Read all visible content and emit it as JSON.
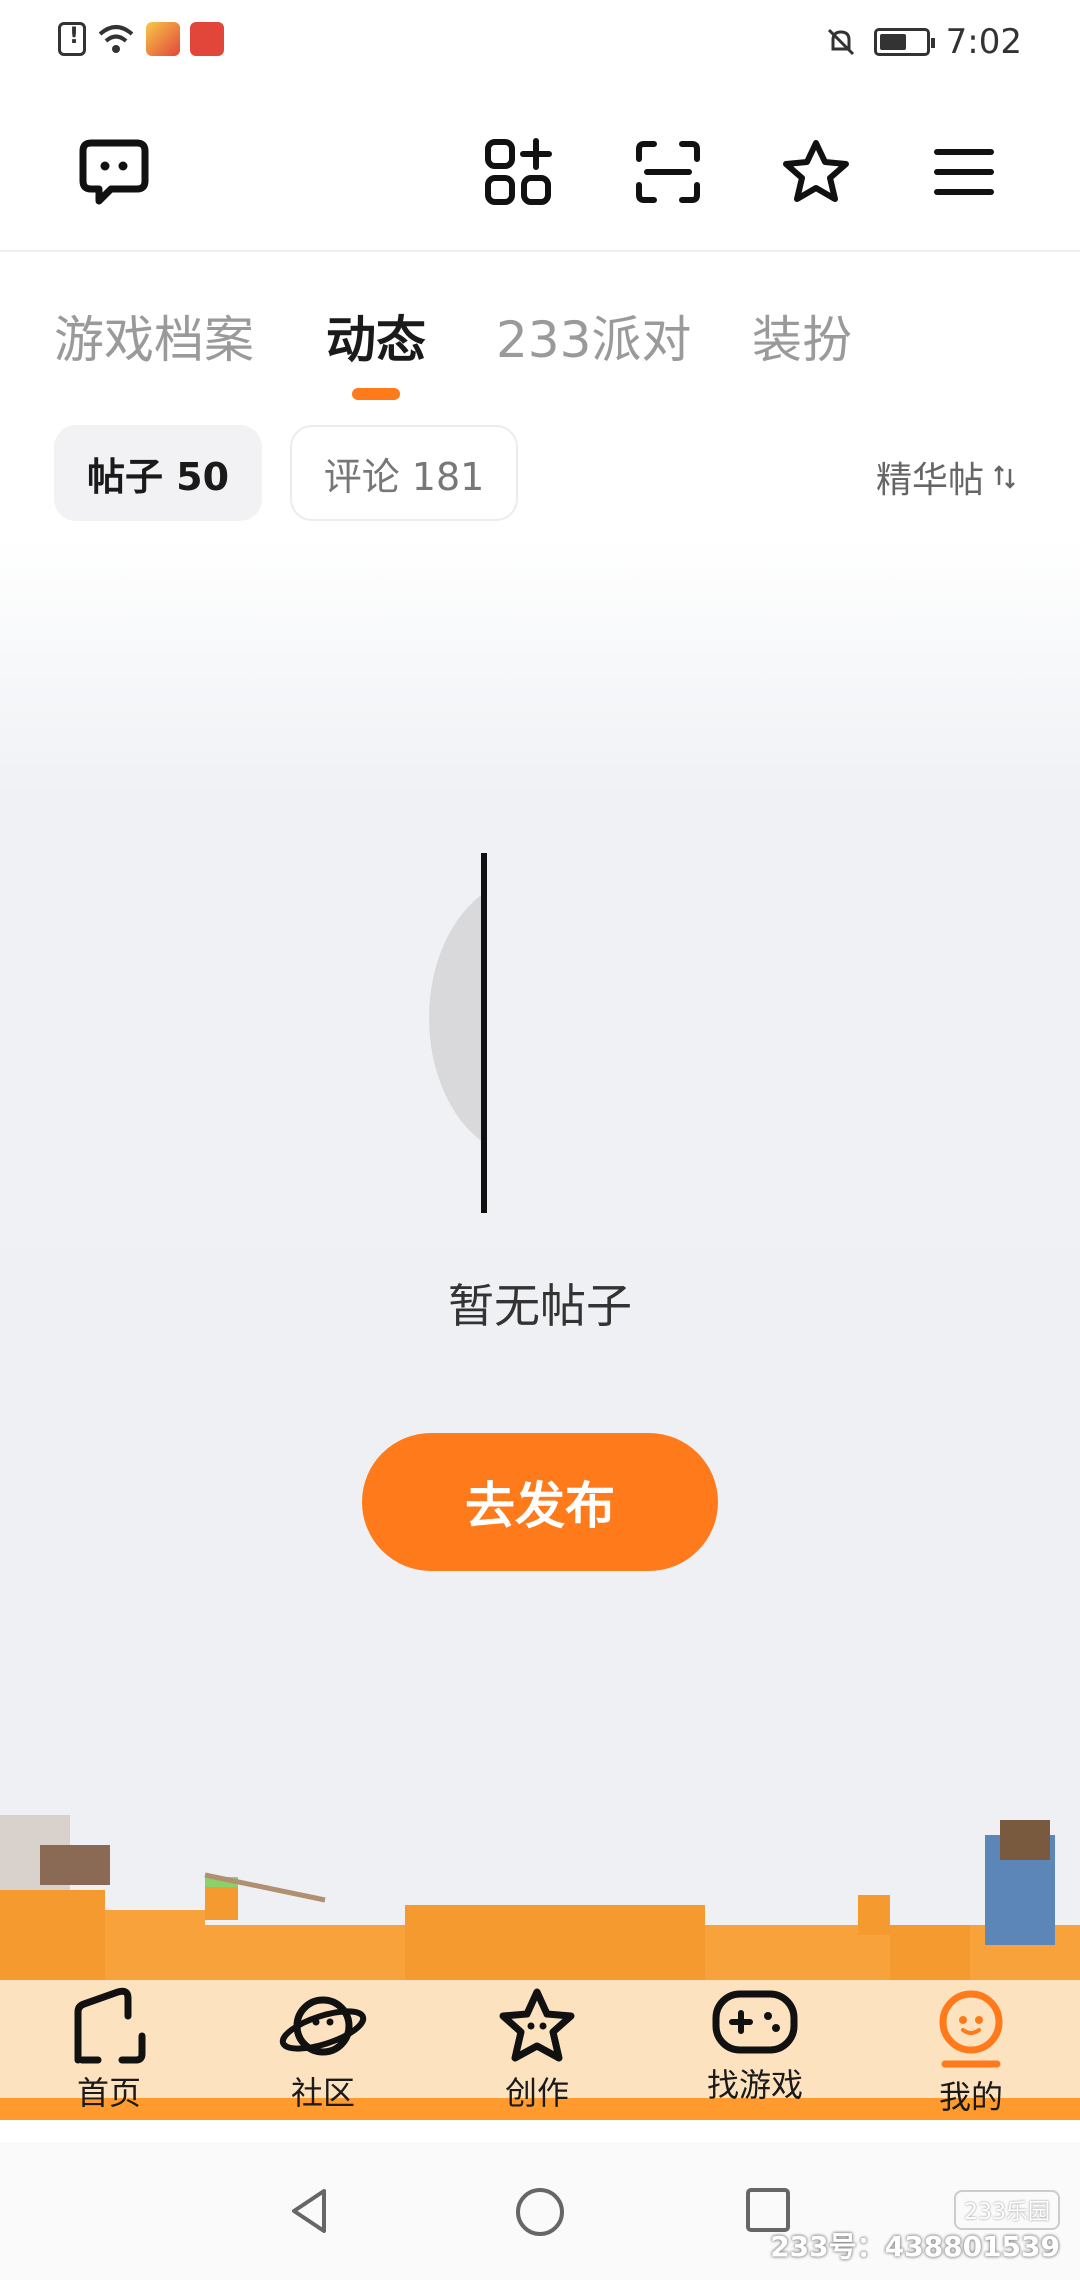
{
  "status_bar": {
    "time": "7:02"
  },
  "tabs": [
    {
      "label": "游戏档案"
    },
    {
      "label": "动态"
    },
    {
      "label": "233派对"
    },
    {
      "label": "装扮"
    }
  ],
  "filters": {
    "posts": "帖子 50",
    "comments": "评论 181",
    "sort": "精华帖"
  },
  "empty": {
    "text": "暂无帖子",
    "button": "去发布"
  },
  "bottom_nav": [
    {
      "label": "首页",
      "icon": "home-icon"
    },
    {
      "label": "社区",
      "icon": "planet-icon"
    },
    {
      "label": "创作",
      "icon": "star-icon"
    },
    {
      "label": "找游戏",
      "icon": "gamepad-icon"
    },
    {
      "label": "我的",
      "icon": "profile-icon"
    }
  ],
  "watermark": {
    "logo": "233乐园",
    "id": "233号：438801539"
  },
  "colors": {
    "accent": "#ff7a1a",
    "nav_bg": "#fde2bf"
  }
}
